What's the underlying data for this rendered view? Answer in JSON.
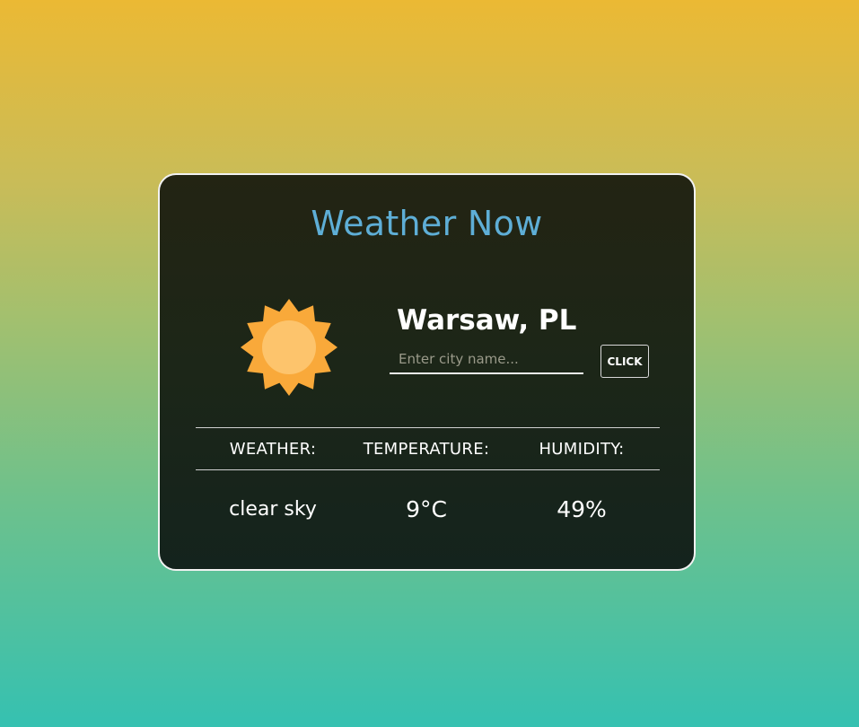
{
  "app": {
    "title": "Weather Now"
  },
  "location": {
    "city": "Warsaw, PL"
  },
  "search": {
    "placeholder": "Enter city name...",
    "value": "",
    "button_label": "CLICK"
  },
  "weather_icon": {
    "name": "sun-icon",
    "colors": {
      "rays": "#f9a93a",
      "core": "#fdc46c"
    }
  },
  "stats": {
    "headers": {
      "weather": "WEATHER:",
      "temperature": "TEMPERATURE:",
      "humidity": "HUMIDITY:"
    },
    "values": {
      "weather": "clear sky",
      "temperature": "9°C",
      "humidity": "49%"
    }
  },
  "colors": {
    "accent_title": "#5eaed6",
    "background_top": "#ebb934",
    "background_bottom": "#35c1b1",
    "card_background": "#1f2516"
  }
}
